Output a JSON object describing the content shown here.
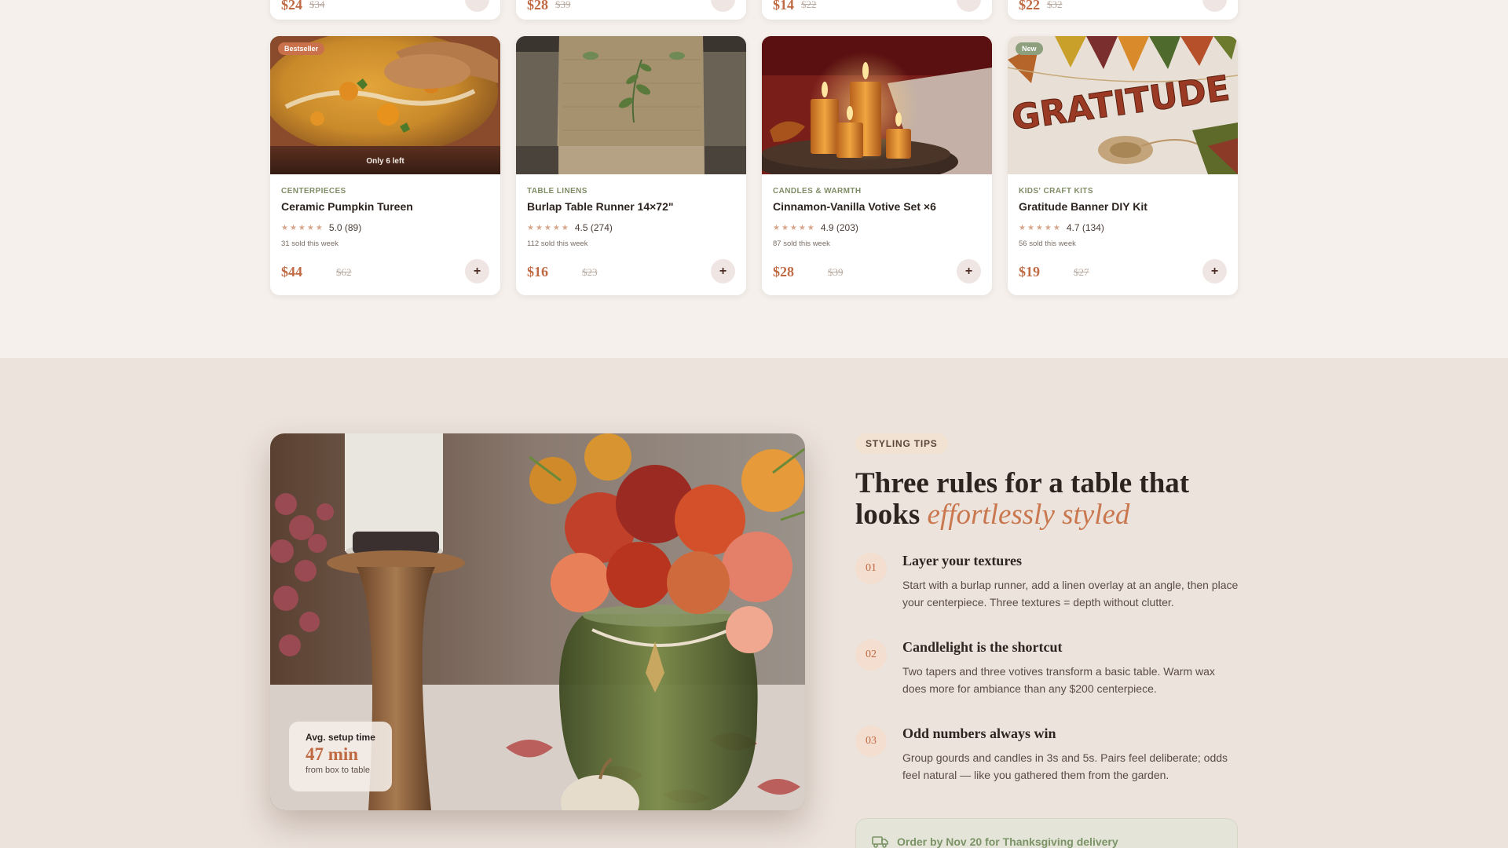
{
  "partial_cards": [
    {
      "price": "$24",
      "old_price": "$34"
    },
    {
      "price": "$28",
      "old_price": "$39"
    },
    {
      "price": "$14",
      "old_price": "$22"
    },
    {
      "price": "$22",
      "old_price": "$32"
    }
  ],
  "products": [
    {
      "badge": "Bestseller",
      "stock": "Only 6 left",
      "category": "CENTERPIECES",
      "name": "Ceramic Pumpkin Tureen",
      "stars": "★★★★★",
      "rating": "5.0 (89)",
      "sold": "31 sold this week",
      "price": "$44",
      "old_price": "$62",
      "add_label": "+"
    },
    {
      "badge": "",
      "stock": "",
      "category": "TABLE LINENS",
      "name": "Burlap Table Runner 14×72\"",
      "stars": "★★★★★",
      "rating": "4.5 (274)",
      "sold": "112 sold this week",
      "price": "$16",
      "old_price": "$23",
      "add_label": "+"
    },
    {
      "badge": "",
      "stock": "",
      "category": "CANDLES & WARMTH",
      "name": "Cinnamon-Vanilla Votive Set ×6",
      "stars": "★★★★★",
      "rating": "4.9 (203)",
      "sold": "87 sold this week",
      "price": "$28",
      "old_price": "$39",
      "add_label": "+"
    },
    {
      "badge": "New",
      "stock": "",
      "category": "KIDS' CRAFT KITS",
      "name": "Gratitude Banner DIY Kit",
      "stars": "★★★★★",
      "rating": "4.7 (134)",
      "sold": "56 sold this week",
      "price": "$19",
      "old_price": "$27",
      "add_label": "+"
    }
  ],
  "tips": {
    "pill": "STYLING TIPS",
    "heading_plain": "Three rules for a table that looks ",
    "heading_accent": "effortlessly styled",
    "rules": [
      {
        "num": "01",
        "title": "Layer your textures",
        "text": "Start with a burlap runner, add a linen overlay at an angle, then place your centerpiece. Three textures = depth without clutter."
      },
      {
        "num": "02",
        "title": "Candlelight is the shortcut",
        "text": "Two tapers and three votives transform a basic table. Warm wax does more for ambiance than any $200 centerpiece."
      },
      {
        "num": "03",
        "title": "Odd numbers always win",
        "text": "Group gourds and candles in 3s and 5s. Pairs feel deliberate; odds feel natural — like you gathered them from the garden."
      }
    ],
    "setup": {
      "title": "Avg. setup time",
      "value": "47 min",
      "sub": "from box to table"
    },
    "delivery": "Order by Nov 20 for Thanksgiving delivery",
    "banner_word": "GRATITUDE"
  },
  "colors": {
    "accent": "#c06a43",
    "sage": "#7f8d66",
    "bg": "#f5f0ec",
    "section_bg": "#ece3dc"
  }
}
